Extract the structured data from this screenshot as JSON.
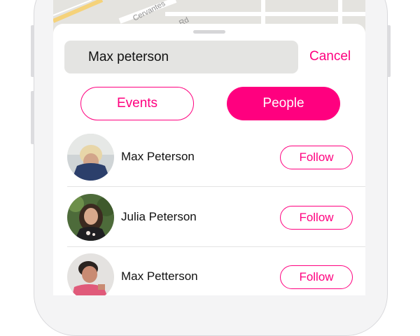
{
  "map": {
    "street_label": "Cervantes",
    "street_label_2": "Rd"
  },
  "search": {
    "query": "Max peterson"
  },
  "cancel_label": "Cancel",
  "segments": {
    "events": "Events",
    "people": "People",
    "active": "People"
  },
  "people": [
    {
      "name": "Max Peterson",
      "follow_label": "Follow"
    },
    {
      "name": "Julia Peterson",
      "follow_label": "Follow"
    },
    {
      "name": "Max Petterson",
      "follow_label": "Follow"
    }
  ],
  "colors": {
    "accent": "#ff007f",
    "search_bg": "#e4e4e2",
    "map_bg": "#e4e3df"
  }
}
